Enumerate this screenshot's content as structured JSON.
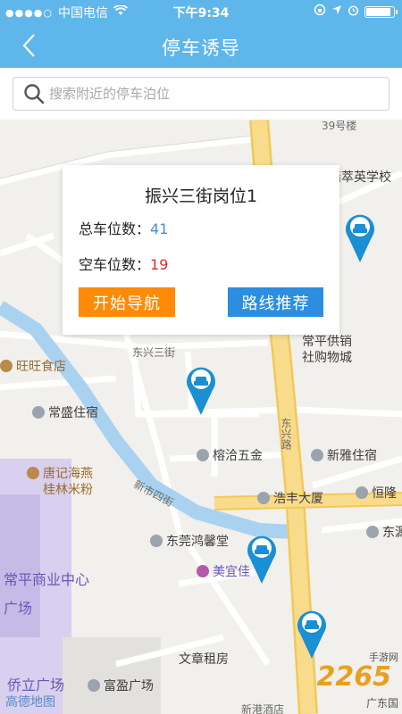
{
  "status_bar": {
    "signal": "●●●●○",
    "carrier": "中国电信",
    "time": "下午9:34",
    "battery_level": 0.9
  },
  "nav": {
    "title": "停车诱导"
  },
  "search": {
    "placeholder": "搜索附近的停车泊位"
  },
  "popup": {
    "name": "振兴三街岗位1",
    "total_label": "总车位数：",
    "total_value": "41",
    "empty_label": "空车位数：",
    "empty_value": "19",
    "nav_button": "开始导航",
    "route_button": "路线推荐"
  },
  "map": {
    "labels": {
      "building_39": "39号楼",
      "school": "樯萃英学校",
      "dongxing_3rd": "东兴三街",
      "wangwang": "旺旺食店",
      "changping_supply": "常平供销",
      "social_city": "社购物城",
      "changsheng": "常盛住宿",
      "rongqia": "榕洽五金",
      "dongxing_road": "东兴路",
      "xinya": "新雅住宿",
      "tangji": "唐记海燕",
      "guilin_rice": "桂林米粉",
      "xinshi_4th": "新市四街",
      "haofeng": "浩丰大厦",
      "henglong": "恒隆",
      "dongguan_hongxin": "东莞鸿馨堂",
      "meiyijia": "美宜佳",
      "dongyuan": "东源",
      "changping_center": "常平商业中心",
      "square": "广场",
      "wenzhang": "文章租房",
      "qiaoli_square": "侨立广场",
      "fuying_square": "富盈广场",
      "amap": "高德地图",
      "xingang": "新港酒店"
    },
    "colors": {
      "main_road": "#f7d77f",
      "road": "#ffffff",
      "river": "#a9d2f0",
      "block_purple": "#c9bfe8",
      "pin": "#1a8fd3"
    }
  },
  "watermark": {
    "logo": "2265",
    "suffix": "手游网",
    "region": "广东国"
  }
}
